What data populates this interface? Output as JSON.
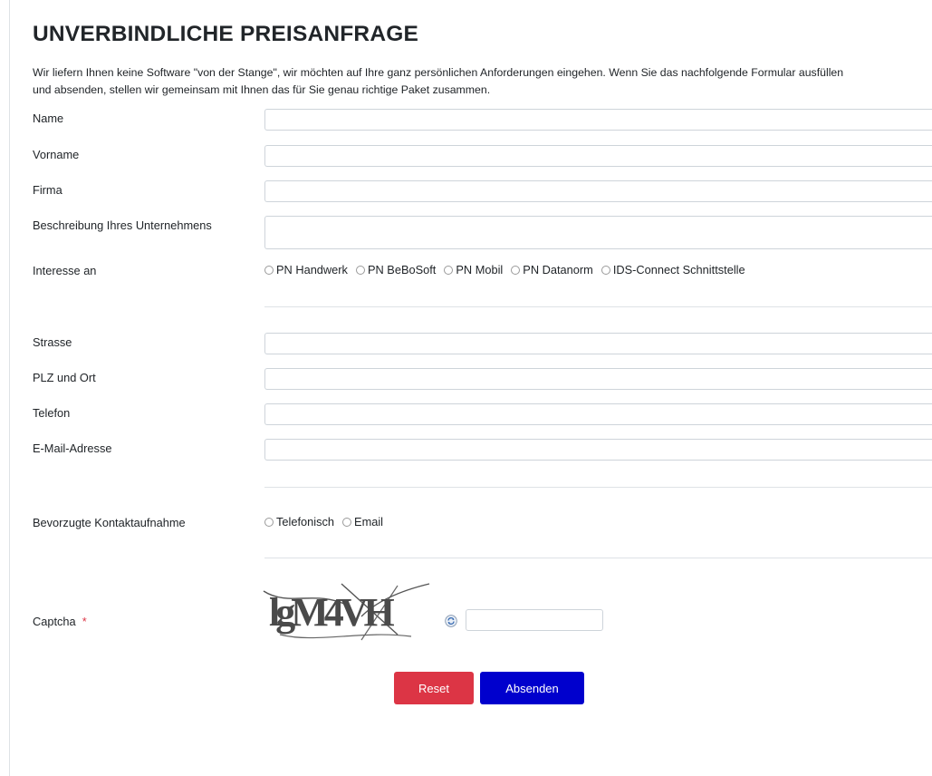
{
  "form": {
    "title": "UNVERBINDLICHE PREISANFRAGE",
    "intro_line1": "Wir liefern Ihnen keine Software \"von der Stange\", wir möchten auf Ihre ganz persönlichen Anforderungen eingehen. Wenn Sie das nachfolgende Formular ausfüllen",
    "intro_line2": "und absenden, stellen wir gemeinsam mit Ihnen das für Sie genau richtige Paket zusammen.",
    "fields": {
      "name": {
        "label": "Name",
        "value": ""
      },
      "vorname": {
        "label": "Vorname",
        "value": ""
      },
      "firma": {
        "label": "Firma",
        "value": ""
      },
      "beschreibung": {
        "label": "Beschreibung Ihres Unternehmens",
        "value": ""
      },
      "strasse": {
        "label": "Strasse",
        "value": ""
      },
      "plz_ort": {
        "label": "PLZ und Ort",
        "value": ""
      },
      "telefon": {
        "label": "Telefon",
        "value": ""
      },
      "email": {
        "label": "E-Mail-Adresse",
        "value": ""
      }
    },
    "interesse": {
      "label": "Interesse an",
      "options": [
        "PN Handwerk",
        "PN BeBoSoft",
        "PN Mobil",
        "PN Datanorm",
        "IDS-Connect Schnittstelle"
      ]
    },
    "kontakt": {
      "label": "Bevorzugte Kontaktaufnahme",
      "options": [
        "Telefonisch",
        "Email"
      ]
    },
    "captcha": {
      "label": "Captcha",
      "required_mark": "*",
      "image_text": "lgM4VH",
      "input_value": ""
    },
    "buttons": {
      "reset": "Reset",
      "submit": "Absenden"
    },
    "colors": {
      "reset_button": "#dc3545",
      "submit_button": "#0000cd",
      "required_mark": "#dc3545"
    },
    "icons": [
      "refresh-icon"
    ]
  }
}
